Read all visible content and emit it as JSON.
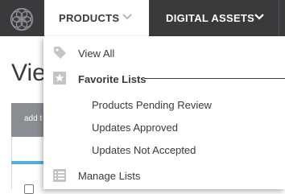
{
  "nav": {
    "products_label": "PRODUCTS",
    "digital_assets_label": "DIGITAL ASSETS"
  },
  "page": {
    "heading": "Vie",
    "table_header_label": "add t"
  },
  "dropdown": {
    "view_all": "View All",
    "favorite_lists_heading": "Favorite Lists",
    "favorites": [
      "Products Pending Review",
      "Updates Approved",
      "Updates Not Accepted"
    ],
    "manage_lists": "Manage Lists"
  },
  "icons": {
    "logo": "flower-logo-icon",
    "products_chevron": "chevron-down-icon",
    "digital_assets_chevron": "chevron-down-icon",
    "view_all": "tag-icon",
    "favorite_lists": "star-list-icon",
    "manage_lists": "list-icon"
  },
  "colors": {
    "topbar": "#3a3a3d",
    "accent": "#4fb0d8",
    "icon_gray": "#c4c4c4"
  }
}
